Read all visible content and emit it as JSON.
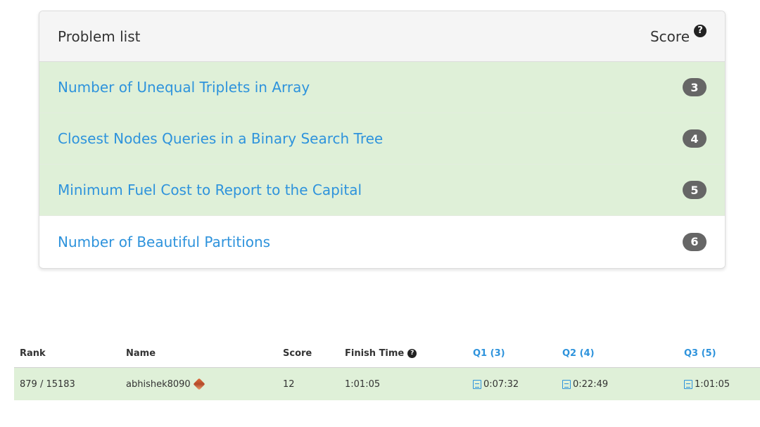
{
  "panel": {
    "title": "Problem list",
    "score_label": "Score",
    "help_glyph": "?",
    "problems": [
      {
        "title": "Number of Unequal Triplets in Array",
        "score": "3",
        "solved": true
      },
      {
        "title": "Closest Nodes Queries in a Binary Search Tree",
        "score": "4",
        "solved": true
      },
      {
        "title": "Minimum Fuel Cost to Report to the Capital",
        "score": "5",
        "solved": true
      },
      {
        "title": "Number of Beautiful Partitions",
        "score": "6",
        "solved": false
      }
    ]
  },
  "ranking": {
    "headers": {
      "rank": "Rank",
      "name": "Name",
      "score": "Score",
      "finish_time": "Finish Time",
      "q1": "Q1 (3)",
      "q2": "Q2 (4)",
      "q3": "Q3 (5)"
    },
    "row": {
      "rank": "879 / 15183",
      "name": "abhishek8090",
      "score": "12",
      "finish_time": "1:01:05",
      "q1": "0:07:32",
      "q2": "0:22:49",
      "q3": "1:01:05"
    }
  },
  "colors": {
    "solved_bg": "#dff0d8",
    "link": "#2e93dc",
    "badge": "#666666"
  }
}
